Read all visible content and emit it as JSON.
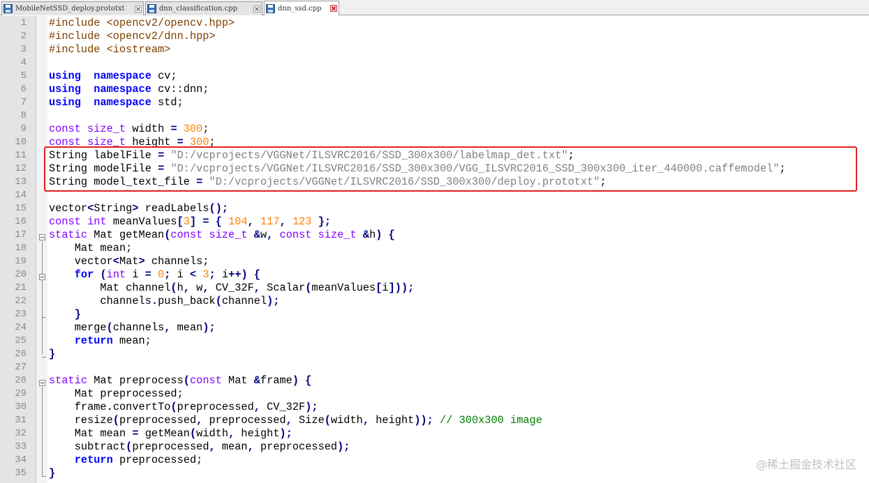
{
  "tabs": [
    {
      "label": "MobileNetSSD_deploy.prototxt",
      "active": false
    },
    {
      "label": "dnn_classification.cpp",
      "active": false
    },
    {
      "label": "dnn_ssd.cpp",
      "active": true
    }
  ],
  "watermark": "@稀土掘金技术社区",
  "line_numbers": [
    "1",
    "2",
    "3",
    "4",
    "5",
    "6",
    "7",
    "8",
    "9",
    "10",
    "11",
    "12",
    "13",
    "14",
    "15",
    "16",
    "17",
    "18",
    "19",
    "20",
    "21",
    "22",
    "23",
    "24",
    "25",
    "26",
    "27",
    "28",
    "29",
    "30",
    "31",
    "32",
    "33",
    "34",
    "35"
  ],
  "lines": [
    [
      [
        "pre",
        "#include <opencv2/opencv.hpp>"
      ]
    ],
    [
      [
        "pre",
        "#include <opencv2/dnn.hpp>"
      ]
    ],
    [
      [
        "pre",
        "#include <iostream>"
      ]
    ],
    [],
    [
      [
        "kw",
        "using"
      ],
      [
        "",
        "  "
      ],
      [
        "kw",
        "namespace"
      ],
      [
        "",
        " cv;"
      ]
    ],
    [
      [
        "kw",
        "using"
      ],
      [
        "",
        "  "
      ],
      [
        "kw",
        "namespace"
      ],
      [
        "",
        " cv::dnn;"
      ]
    ],
    [
      [
        "kw",
        "using"
      ],
      [
        "",
        "  "
      ],
      [
        "kw",
        "namespace"
      ],
      [
        "",
        " std;"
      ]
    ],
    [],
    [
      [
        "ty",
        "const"
      ],
      [
        "",
        " "
      ],
      [
        "ty",
        "size_t"
      ],
      [
        "",
        " width "
      ],
      [
        "op",
        "="
      ],
      [
        "",
        " "
      ],
      [
        "num",
        "300"
      ],
      [
        "",
        ";"
      ]
    ],
    [
      [
        "ty",
        "const"
      ],
      [
        "",
        " "
      ],
      [
        "ty",
        "size_t"
      ],
      [
        "",
        " height "
      ],
      [
        "op",
        "="
      ],
      [
        "",
        " "
      ],
      [
        "num",
        "300"
      ],
      [
        "",
        ";"
      ]
    ],
    [
      [
        "",
        "String labelFile "
      ],
      [
        "op",
        "="
      ],
      [
        "",
        " "
      ],
      [
        "str",
        "\"D:/vcprojects/VGGNet/ILSVRC2016/SSD_300x300/labelmap_det.txt\""
      ],
      [
        "",
        ";"
      ]
    ],
    [
      [
        "",
        "String modelFile "
      ],
      [
        "op",
        "="
      ],
      [
        "",
        " "
      ],
      [
        "str",
        "\"D:/vcprojects/VGGNet/ILSVRC2016/SSD_300x300/VGG_ILSVRC2016_SSD_300x300_iter_440000.caffemodel\""
      ],
      [
        "",
        ";"
      ]
    ],
    [
      [
        "",
        "String model_text_file "
      ],
      [
        "op",
        "="
      ],
      [
        "",
        " "
      ],
      [
        "str",
        "\"D:/vcprojects/VGGNet/ILSVRC2016/SSD_300x300/deploy.prototxt\""
      ],
      [
        "",
        ";"
      ]
    ],
    [],
    [
      [
        "",
        "vector"
      ],
      [
        "op",
        "<"
      ],
      [
        "",
        "String"
      ],
      [
        "op",
        ">"
      ],
      [
        "",
        " readLabels"
      ],
      [
        "op",
        "();"
      ]
    ],
    [
      [
        "ty",
        "const"
      ],
      [
        "",
        " "
      ],
      [
        "ty",
        "int"
      ],
      [
        "",
        " meanValues"
      ],
      [
        "op",
        "["
      ],
      [
        "num",
        "3"
      ],
      [
        "op",
        "]"
      ],
      [
        "",
        " "
      ],
      [
        "op",
        "="
      ],
      [
        "",
        " "
      ],
      [
        "op",
        "{"
      ],
      [
        "",
        " "
      ],
      [
        "num",
        "104"
      ],
      [
        "op",
        ","
      ],
      [
        "",
        " "
      ],
      [
        "num",
        "117"
      ],
      [
        "op",
        ","
      ],
      [
        "",
        " "
      ],
      [
        "num",
        "123"
      ],
      [
        "",
        " "
      ],
      [
        "op",
        "};"
      ]
    ],
    [
      [
        "ty",
        "static"
      ],
      [
        "",
        " Mat getMean"
      ],
      [
        "op",
        "("
      ],
      [
        "ty",
        "const"
      ],
      [
        "",
        " "
      ],
      [
        "ty",
        "size_t"
      ],
      [
        "",
        " "
      ],
      [
        "op",
        "&"
      ],
      [
        "",
        "w"
      ],
      [
        "op",
        ","
      ],
      [
        "",
        " "
      ],
      [
        "ty",
        "const"
      ],
      [
        "",
        " "
      ],
      [
        "ty",
        "size_t"
      ],
      [
        "",
        " "
      ],
      [
        "op",
        "&"
      ],
      [
        "",
        "h"
      ],
      [
        "op",
        ")"
      ],
      [
        "",
        " "
      ],
      [
        "op",
        "{"
      ]
    ],
    [
      [
        "",
        "    Mat mean;"
      ]
    ],
    [
      [
        "",
        "    vector"
      ],
      [
        "op",
        "<"
      ],
      [
        "",
        "Mat"
      ],
      [
        "op",
        ">"
      ],
      [
        "",
        " channels;"
      ]
    ],
    [
      [
        "",
        "    "
      ],
      [
        "kw",
        "for"
      ],
      [
        "",
        " "
      ],
      [
        "op",
        "("
      ],
      [
        "ty",
        "int"
      ],
      [
        "",
        " i "
      ],
      [
        "op",
        "="
      ],
      [
        "",
        " "
      ],
      [
        "num",
        "0"
      ],
      [
        "op",
        ";"
      ],
      [
        "",
        " i "
      ],
      [
        "op",
        "<"
      ],
      [
        "",
        " "
      ],
      [
        "num",
        "3"
      ],
      [
        "op",
        ";"
      ],
      [
        "",
        " i"
      ],
      [
        "op",
        "++)"
      ],
      [
        "",
        " "
      ],
      [
        "op",
        "{"
      ]
    ],
    [
      [
        "",
        "        Mat channel"
      ],
      [
        "op",
        "("
      ],
      [
        "",
        "h"
      ],
      [
        "op",
        ","
      ],
      [
        "",
        " w"
      ],
      [
        "op",
        ","
      ],
      [
        "",
        " CV_32F"
      ],
      [
        "op",
        ","
      ],
      [
        "",
        " Scalar"
      ],
      [
        "op",
        "("
      ],
      [
        "",
        "meanValues"
      ],
      [
        "op",
        "["
      ],
      [
        "",
        "i"
      ],
      [
        "op",
        "]));"
      ]
    ],
    [
      [
        "",
        "        channels"
      ],
      [
        "op",
        "."
      ],
      [
        "",
        "push_back"
      ],
      [
        "op",
        "("
      ],
      [
        "",
        "channel"
      ],
      [
        "op",
        ");"
      ]
    ],
    [
      [
        "",
        "    "
      ],
      [
        "op",
        "}"
      ]
    ],
    [
      [
        "",
        "    merge"
      ],
      [
        "op",
        "("
      ],
      [
        "",
        "channels"
      ],
      [
        "op",
        ","
      ],
      [
        "",
        " mean"
      ],
      [
        "op",
        ");"
      ]
    ],
    [
      [
        "",
        "    "
      ],
      [
        "kw",
        "return"
      ],
      [
        "",
        " mean;"
      ]
    ],
    [
      [
        "op",
        "}"
      ]
    ],
    [],
    [
      [
        "ty",
        "static"
      ],
      [
        "",
        " Mat preprocess"
      ],
      [
        "op",
        "("
      ],
      [
        "ty",
        "const"
      ],
      [
        "",
        " Mat "
      ],
      [
        "op",
        "&"
      ],
      [
        "",
        "frame"
      ],
      [
        "op",
        ")"
      ],
      [
        "",
        " "
      ],
      [
        "op",
        "{"
      ]
    ],
    [
      [
        "",
        "    Mat preprocessed;"
      ]
    ],
    [
      [
        "",
        "    frame"
      ],
      [
        "op",
        "."
      ],
      [
        "",
        "convertTo"
      ],
      [
        "op",
        "("
      ],
      [
        "",
        "preprocessed"
      ],
      [
        "op",
        ","
      ],
      [
        "",
        " CV_32F"
      ],
      [
        "op",
        ");"
      ]
    ],
    [
      [
        "",
        "    resize"
      ],
      [
        "op",
        "("
      ],
      [
        "",
        "preprocessed"
      ],
      [
        "op",
        ","
      ],
      [
        "",
        " preprocessed"
      ],
      [
        "op",
        ","
      ],
      [
        "",
        " Size"
      ],
      [
        "op",
        "("
      ],
      [
        "",
        "width"
      ],
      [
        "op",
        ","
      ],
      [
        "",
        " height"
      ],
      [
        "op",
        "));"
      ],
      [
        "",
        " "
      ],
      [
        "cm",
        "// 300x300 image"
      ]
    ],
    [
      [
        "",
        "    Mat mean "
      ],
      [
        "op",
        "="
      ],
      [
        "",
        " getMean"
      ],
      [
        "op",
        "("
      ],
      [
        "",
        "width"
      ],
      [
        "op",
        ","
      ],
      [
        "",
        " height"
      ],
      [
        "op",
        ");"
      ]
    ],
    [
      [
        "",
        "    subtract"
      ],
      [
        "op",
        "("
      ],
      [
        "",
        "preprocessed"
      ],
      [
        "op",
        ","
      ],
      [
        "",
        " mean"
      ],
      [
        "op",
        ","
      ],
      [
        "",
        " preprocessed"
      ],
      [
        "op",
        ");"
      ]
    ],
    [
      [
        "",
        "    "
      ],
      [
        "kw",
        "return"
      ],
      [
        "",
        " preprocessed;"
      ]
    ],
    [
      [
        "op",
        "}"
      ]
    ]
  ],
  "colors": {
    "keyword": "#0000ff",
    "type": "#8000ff",
    "number": "#ff8000",
    "string": "#808080",
    "preprocessor": "#804000",
    "operator": "#000080",
    "comment": "#008000",
    "highlight": "#e02020"
  }
}
